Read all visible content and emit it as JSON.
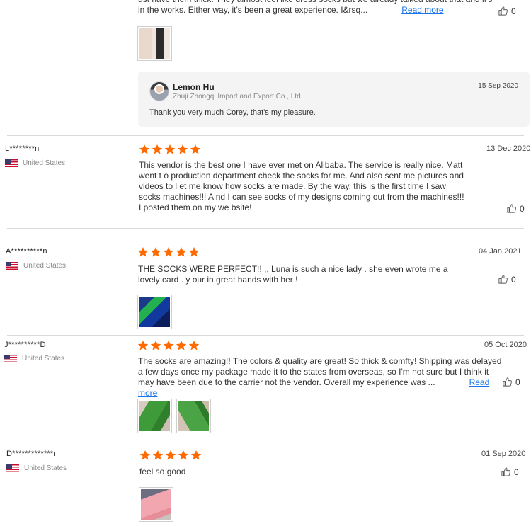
{
  "reviews": [
    {
      "text": "ust have them thick. They almost feel like dress socks but we already talked about that and it's in the works. Either way, it's been a great experience. I&rsq...",
      "more": "Read more",
      "likes": "0",
      "reply": {
        "name": "Lemon Hu",
        "company": "Zhuji Zhongqi Import and Export Co., Ltd.",
        "date": "15 Sep 2020",
        "text": "Thank you very much Corey, that's my pleasure."
      }
    },
    {
      "reviewer": "L********n",
      "country": "United States",
      "rating": 5,
      "date": "13 Dec 2020",
      "text": "This vendor is the best one I have ever met on Alibaba. The service is really nice. Matt went t o production department check the socks for me. And also sent me pictures and videos to l et me know how socks are made. By the way, this is the first time I saw socks machines!!! A nd I can see socks of my designs coming out from the machines!!! I posted them on my we bsite!",
      "likes": "0"
    },
    {
      "reviewer": "A**********n",
      "country": "United States",
      "rating": 5,
      "date": "04 Jan 2021",
      "text": "THE SOCKS WERE PERFECT!! ,, Luna is such a nice lady . she even wrote me a lovely card . y our in great hands with her !",
      "likes": "0"
    },
    {
      "reviewer": "J**********D",
      "country": "United States",
      "rating": 5,
      "date": "05 Oct 2020",
      "text": "The socks are amazing!! The colors & quality are great! So thick & comfty! Shipping was delayed a few days once my package made it to the states from overseas, so I'm not sure but I think it may have been due to the carrier not the vendor. Overall my experience was ...",
      "more": "Read more",
      "likes": "0"
    },
    {
      "reviewer": "D*************r",
      "country": "United States",
      "rating": 5,
      "date": "01 Sep 2020",
      "text": "feel so good",
      "likes": "0"
    }
  ],
  "colors": {
    "star": "#ff6a00",
    "link": "#1a73e8"
  },
  "icons": {
    "star": "star-icon",
    "like": "thumbs-up-icon",
    "flag": "us-flag-icon"
  }
}
